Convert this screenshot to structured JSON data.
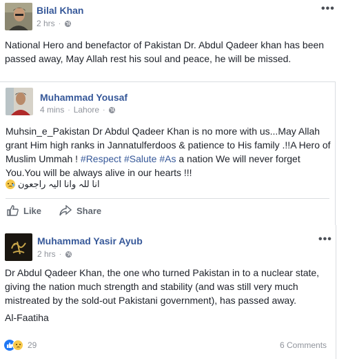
{
  "post1": {
    "author": "Bilal Khan",
    "time": "2 hrs",
    "text": "National Hero and benefactor of Pakistan Dr. Abdul Qadeer khan has been passed away, May Allah rest his soul and peace, he will be missed.",
    "more_label": "•••"
  },
  "shared": {
    "author": "Muhammad Yousaf",
    "time": "4 mins",
    "location": "Lahore",
    "text_part1": "Muhsin_e_Pakistan Dr Abdul Qadeer Khan is no more with us...May Allah grant Him high ranks in Jannatulferdoos & patience to His family .!!A Hero of Muslim Ummah ! ",
    "hashtag1": "#Respect",
    "hashtag2": "#Salute",
    "hashtag3": "#As",
    "text_part2": " a nation We will never forget You.You will be always alive in our hearts !!!",
    "urdu": "انا للہ وانا الیہ راجعون",
    "actions": {
      "like": "Like",
      "share": "Share"
    }
  },
  "post2": {
    "author": "Muhammad Yasir Ayub",
    "time": "2 hrs",
    "text": "Dr Abdul Qadeer Khan, the one who turned Pakistan in to a nuclear state, giving the nation much strength and stability (and was still very much mistreated by the sold-out Pakistani government), has passed away.",
    "text2": "Al-Faatiha",
    "more_label": "•••",
    "reactions_count": "29",
    "comments": "6 Comments"
  },
  "colors": {
    "link": "#365899",
    "meta": "#90949c",
    "like_blue": "#2078f4",
    "sad_yellow": "#f7c94c"
  }
}
